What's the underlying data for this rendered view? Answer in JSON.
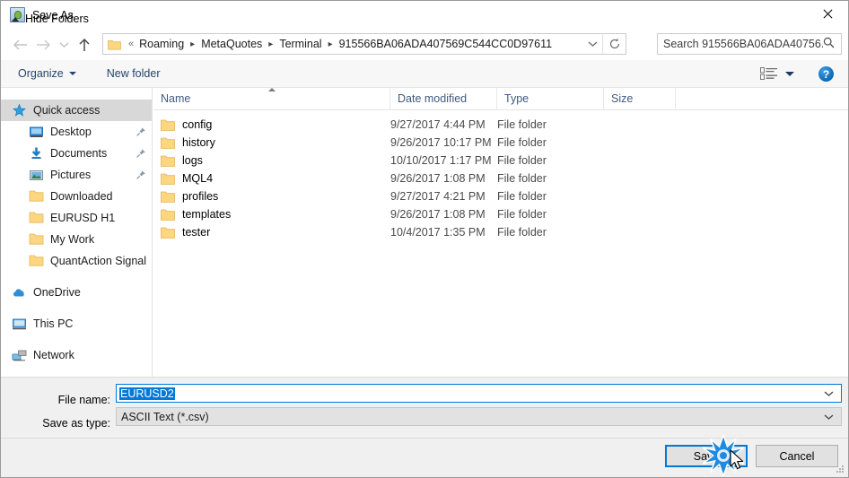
{
  "window": {
    "title": "Save As",
    "app_icon": "save-as-app-icon",
    "close_label": "✕"
  },
  "nav": {
    "back": "back-arrow",
    "forward": "forward-arrow",
    "recent": "recent-locations-chevron",
    "up": "up-arrow",
    "refresh": "refresh-icon",
    "dropdown": "address-dropdown-chevron",
    "breadcrumb_prefix": "«",
    "breadcrumbs": [
      "Roaming",
      "MetaQuotes",
      "Terminal",
      "915566BA06ADA407569C544CC0D97611"
    ]
  },
  "search": {
    "placeholder": "Search 915566BA06ADA40756...",
    "icon": "search-icon"
  },
  "toolbar": {
    "organize_label": "Organize",
    "new_folder_label": "New folder",
    "view_icon": "list-view-icon",
    "view_caret": "chevron-down-icon",
    "help_label": "?"
  },
  "sidebar": {
    "items": [
      {
        "label": "Quick access",
        "icon": "star-icon",
        "level": 0,
        "selected": true,
        "pinned": false
      },
      {
        "label": "Desktop",
        "icon": "desktop-icon",
        "level": 1,
        "selected": false,
        "pinned": true
      },
      {
        "label": "Documents",
        "icon": "documents-download-icon",
        "level": 1,
        "selected": false,
        "pinned": true
      },
      {
        "label": "Pictures",
        "icon": "pictures-icon",
        "level": 1,
        "selected": false,
        "pinned": true
      },
      {
        "label": "Downloaded",
        "icon": "folder-icon",
        "level": 1,
        "selected": false,
        "pinned": false
      },
      {
        "label": "EURUSD H1",
        "icon": "folder-icon",
        "level": 1,
        "selected": false,
        "pinned": false
      },
      {
        "label": "My Work",
        "icon": "folder-icon",
        "level": 1,
        "selected": false,
        "pinned": false
      },
      {
        "label": "QuantAction Signal",
        "icon": "folder-icon",
        "level": 1,
        "selected": false,
        "pinned": false
      },
      {
        "label": "OneDrive",
        "icon": "onedrive-cloud-icon",
        "level": 0,
        "selected": false,
        "pinned": false,
        "gap_before": true
      },
      {
        "label": "This PC",
        "icon": "this-pc-icon",
        "level": 0,
        "selected": false,
        "pinned": false,
        "gap_before": true
      },
      {
        "label": "Network",
        "icon": "network-icon",
        "level": 0,
        "selected": false,
        "pinned": false,
        "gap_before": true
      }
    ]
  },
  "filelist": {
    "columns": [
      "Name",
      "Date modified",
      "Type",
      "Size"
    ],
    "sort_column": "Name",
    "sort_direction": "ascending",
    "rows": [
      {
        "name": "config",
        "date": "9/27/2017 4:44 PM",
        "type": "File folder",
        "size": ""
      },
      {
        "name": "history",
        "date": "9/26/2017 10:17 PM",
        "type": "File folder",
        "size": ""
      },
      {
        "name": "logs",
        "date": "10/10/2017 1:17 PM",
        "type": "File folder",
        "size": ""
      },
      {
        "name": "MQL4",
        "date": "9/26/2017 1:08 PM",
        "type": "File folder",
        "size": ""
      },
      {
        "name": "profiles",
        "date": "9/27/2017 4:21 PM",
        "type": "File folder",
        "size": ""
      },
      {
        "name": "templates",
        "date": "9/26/2017 1:08 PM",
        "type": "File folder",
        "size": ""
      },
      {
        "name": "tester",
        "date": "10/4/2017 1:35 PM",
        "type": "File folder",
        "size": ""
      }
    ]
  },
  "form": {
    "filename_label": "File name:",
    "filename_value": "EURUSD2",
    "savetype_label": "Save as type:",
    "savetype_value": "ASCII Text (*.csv)",
    "combo_arrow": "chevron-down-icon"
  },
  "footer": {
    "hide_folders_label": "Hide Folders",
    "save_label": "Save",
    "cancel_label": "Cancel"
  },
  "colors": {
    "accent": "#0078d7",
    "selection": "#0078d7",
    "sidebar_selected": "#d8d8d8",
    "folder_yellow": "#fcd77f",
    "column_header_text": "#3f5a80",
    "toolbar_link": "#25456e"
  }
}
